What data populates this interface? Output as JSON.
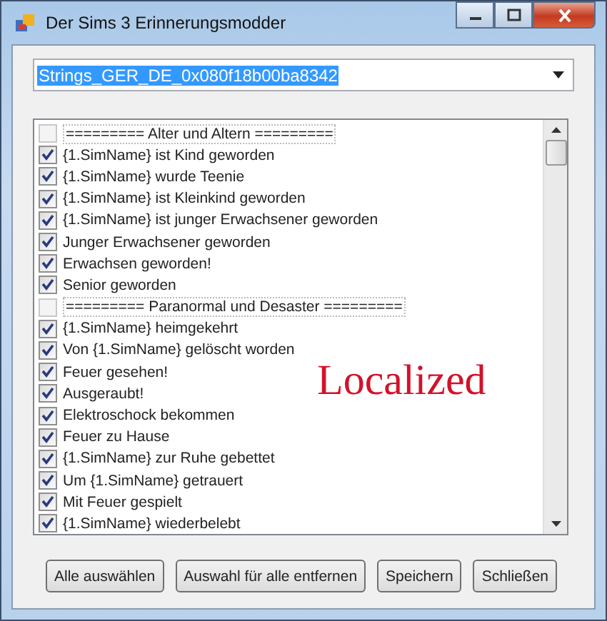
{
  "window": {
    "title": "Der Sims 3 Erinnerungsmodder"
  },
  "combo": {
    "value": "Strings_GER_DE_0x080f18b00ba8342"
  },
  "list": [
    {
      "kind": "header",
      "label": "========= Alter und Altern =========",
      "checked": false
    },
    {
      "kind": "item",
      "label": "{1.SimName} ist Kind geworden",
      "checked": true
    },
    {
      "kind": "item",
      "label": "{1.SimName} wurde Teenie",
      "checked": true
    },
    {
      "kind": "item",
      "label": "{1.SimName} ist Kleinkind geworden",
      "checked": true
    },
    {
      "kind": "item",
      "label": "{1.SimName} ist junger Erwachsener geworden",
      "checked": true
    },
    {
      "kind": "item",
      "label": "Junger Erwachsener geworden",
      "checked": true
    },
    {
      "kind": "item",
      "label": "Erwachsen geworden!",
      "checked": true
    },
    {
      "kind": "item",
      "label": "Senior geworden",
      "checked": true
    },
    {
      "kind": "header",
      "label": "========= Paranormal und Desaster =========",
      "checked": false
    },
    {
      "kind": "item",
      "label": "{1.SimName} heimgekehrt",
      "checked": true
    },
    {
      "kind": "item",
      "label": "Von {1.SimName} gelöscht worden",
      "checked": true
    },
    {
      "kind": "item",
      "label": "Feuer gesehen!",
      "checked": true
    },
    {
      "kind": "item",
      "label": "Ausgeraubt!",
      "checked": true
    },
    {
      "kind": "item",
      "label": "Elektroschock bekommen",
      "checked": true
    },
    {
      "kind": "item",
      "label": "Feuer zu Hause",
      "checked": true
    },
    {
      "kind": "item",
      "label": "{1.SimName} zur Ruhe gebettet",
      "checked": true
    },
    {
      "kind": "item",
      "label": "Um {1.SimName} getrauert",
      "checked": true
    },
    {
      "kind": "item",
      "label": "Mit Feuer gespielt",
      "checked": true
    },
    {
      "kind": "item",
      "label": "{1.SimName} wiederbelebt",
      "checked": true
    }
  ],
  "overlay_label": "Localized",
  "buttons": [
    "Alle auswählen",
    "Auswahl für alle entfernen",
    "Speichern",
    "Schließen"
  ]
}
